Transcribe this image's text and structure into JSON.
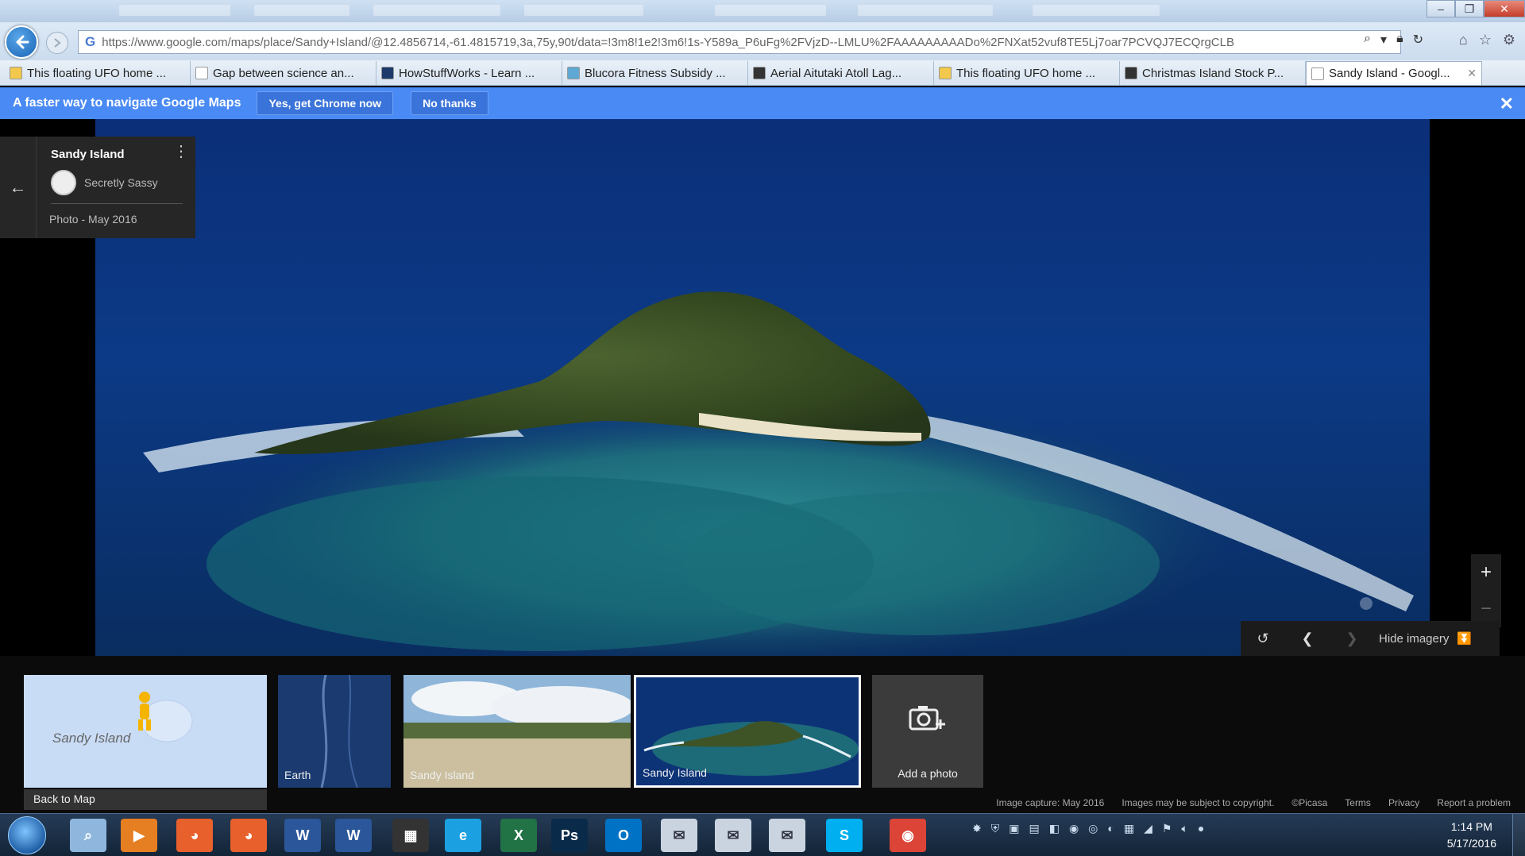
{
  "browser": {
    "url": "https://www.google.com/maps/place/Sandy+Island/@12.4856714,-61.4815719,3a,75y,90t/data=!3m8!1e2!3m6!1s-Y589a_P6uFg%2FVjzD--LMLU%2FAAAAAAAAADo%2FNXat52vuf8TE5Lj7oar7PCVQJ7ECQrgCLB",
    "url_prefix": "G",
    "tabs": [
      {
        "label": "This floating UFO home ...",
        "icon_color": "#f2c94c"
      },
      {
        "label": "Gap between science an...",
        "icon_color": "#ffffff"
      },
      {
        "label": "HowStuffWorks - Learn ...",
        "icon_color": "#1d3a6b"
      },
      {
        "label": "Blucora Fitness Subsidy ...",
        "icon_color": "#5fa8d3"
      },
      {
        "label": "Aerial Aitutaki Atoll Lag...",
        "icon_color": "#333333"
      },
      {
        "label": "This floating UFO home ...",
        "icon_color": "#f2c94c"
      },
      {
        "label": "Christmas Island Stock P...",
        "icon_color": "#333333"
      },
      {
        "label": "Sandy Island - Googl...",
        "icon_color": "#ffffff",
        "active": true
      }
    ]
  },
  "promo": {
    "text": "A faster way to navigate Google Maps",
    "accept": "Yes, get Chrome now",
    "decline": "No thanks"
  },
  "info_card": {
    "title": "Sandy Island",
    "author": "Secretly Sassy",
    "date": "Photo - May 2016"
  },
  "image_controls": {
    "hide_imagery": "Hide imagery"
  },
  "filmstrip": {
    "thumbs": [
      {
        "caption": "Sandy Island",
        "kind": "map"
      },
      {
        "caption": "Earth",
        "kind": "earth"
      },
      {
        "caption": "Sandy Island",
        "kind": "beach"
      },
      {
        "caption": "Sandy Island",
        "kind": "aerial",
        "selected": true
      },
      {
        "caption": "Add a photo",
        "kind": "add"
      }
    ],
    "back_to_map": "Back to Map"
  },
  "footer": {
    "links": [
      "Image capture: May 2016",
      "Images may be subject to copyright.",
      "©Picasa",
      "Terms",
      "Privacy",
      "Report a problem"
    ]
  },
  "taskbar": {
    "apps": [
      "search",
      "media-player",
      "firefox",
      "firefox",
      "word",
      "word",
      "network",
      "internet-explorer",
      "excel",
      "photoshop",
      "outlook",
      "mail",
      "mail",
      "mail",
      "skype",
      "chrome"
    ],
    "time": "1:14 PM",
    "date": "5/17/2016"
  }
}
